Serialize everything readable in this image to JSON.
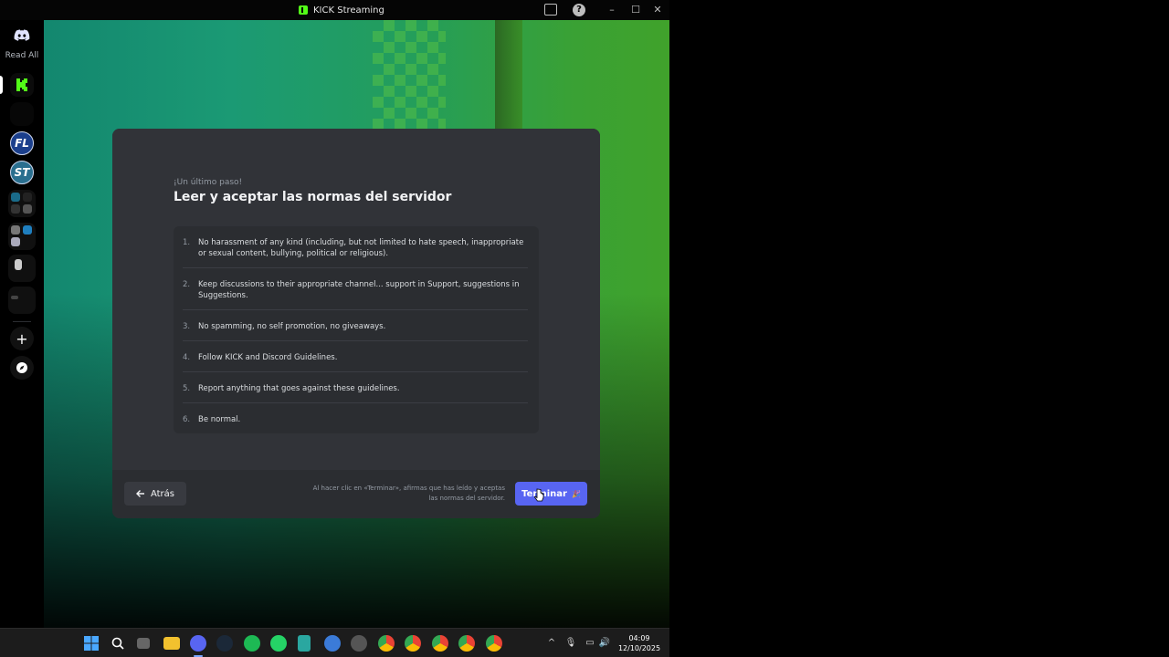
{
  "window": {
    "title": "KICK Streaming"
  },
  "rail": {
    "read_all": "Read All",
    "servers": [
      {
        "icon": "kick-logo",
        "active": true
      },
      {
        "icon": "blank-server"
      },
      {
        "label": "FL"
      },
      {
        "label": "ST"
      }
    ]
  },
  "onboarding": {
    "eyebrow": "¡Un último paso!",
    "title": "Leer y aceptar las normas del servidor",
    "rules": [
      {
        "num": "1.",
        "text": "No harassment of any kind (including, but not limited to hate speech, inappropriate or sexual content, bullying, political or religious)."
      },
      {
        "num": "2.",
        "text": "Keep discussions to their appropriate channel... support in Support, suggestions in Suggestions."
      },
      {
        "num": "3.",
        "text": "No spamming, no self promotion, no giveaways."
      },
      {
        "num": "4.",
        "text": "Follow KICK and Discord Guidelines."
      },
      {
        "num": "5.",
        "text": "Report anything that goes against these guidelines."
      },
      {
        "num": "6.",
        "text": "Be normal."
      }
    ],
    "back_label": "Atrás",
    "footnote": "Al hacer clic en «Terminar», afirmas que has leído y aceptas las normas del servidor.",
    "finish_label": "Terminar",
    "finish_emoji": "🎉"
  },
  "taskbar": {
    "time": "04:09",
    "date": "12/10/2025"
  },
  "colors": {
    "accent": "#5865f2",
    "kick_green": "#53fc18",
    "modal_bg": "#313338"
  }
}
